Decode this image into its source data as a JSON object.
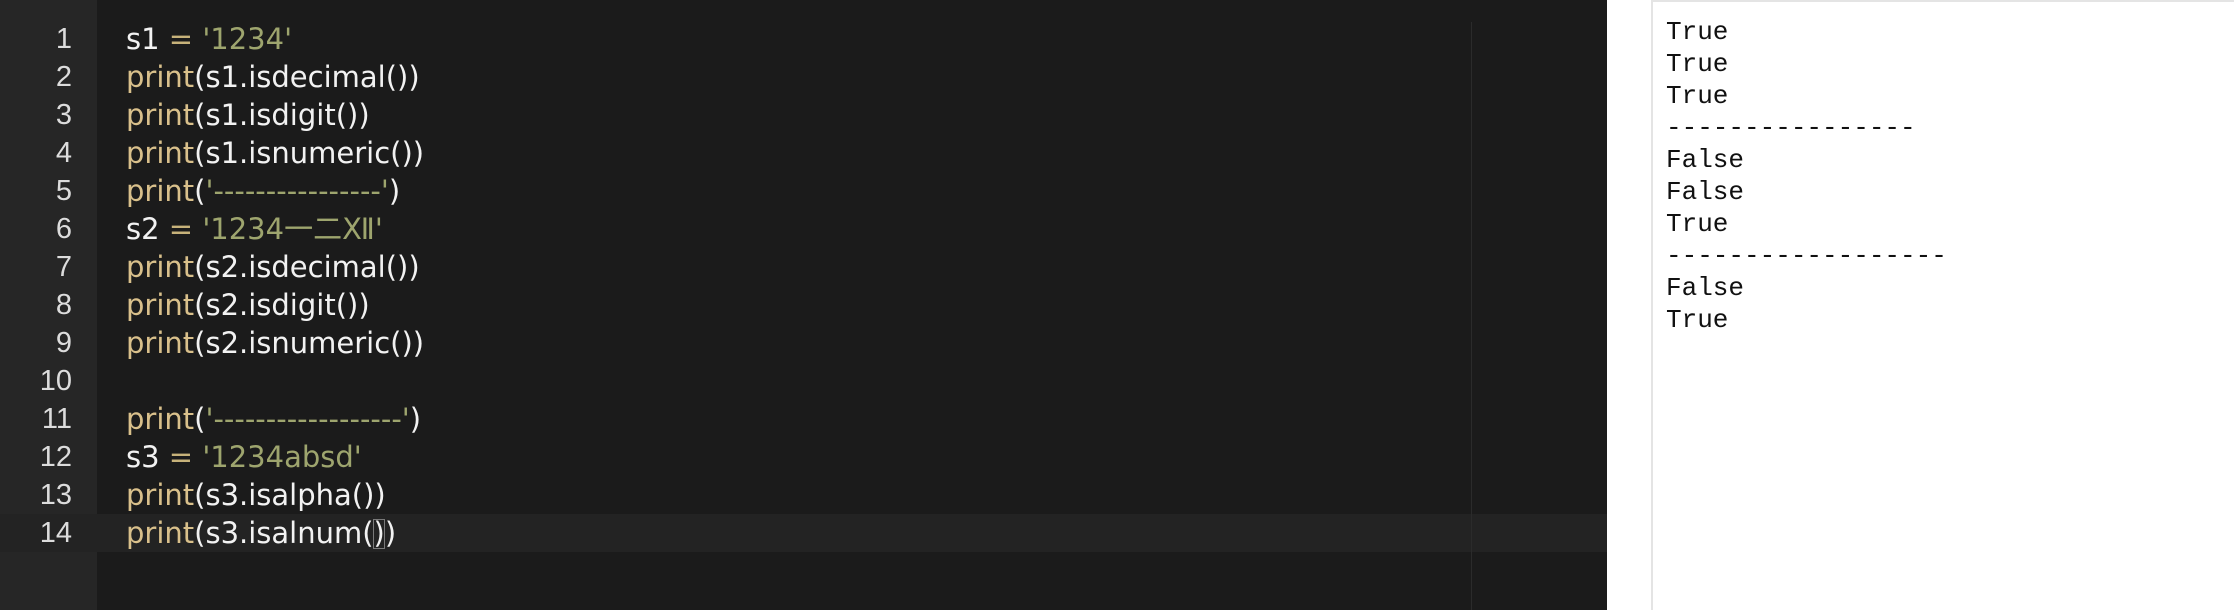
{
  "editor": {
    "lines": [
      {
        "num": "1",
        "parts": [
          {
            "t": "s1 ",
            "c": "plain"
          },
          {
            "t": "=",
            "c": "op"
          },
          {
            "t": " ",
            "c": "plain"
          },
          {
            "t": "'1234'",
            "c": "str"
          }
        ]
      },
      {
        "num": "2",
        "parts": [
          {
            "t": "print",
            "c": "kw"
          },
          {
            "t": "(s1.isdecimal())",
            "c": "plain"
          }
        ]
      },
      {
        "num": "3",
        "parts": [
          {
            "t": "print",
            "c": "kw"
          },
          {
            "t": "(s1.isdigit())",
            "c": "plain"
          }
        ]
      },
      {
        "num": "4",
        "parts": [
          {
            "t": "print",
            "c": "kw"
          },
          {
            "t": "(s1.isnumeric())",
            "c": "plain"
          }
        ]
      },
      {
        "num": "5",
        "parts": [
          {
            "t": "print",
            "c": "kw"
          },
          {
            "t": "(",
            "c": "plain"
          },
          {
            "t": "'----------------'",
            "c": "str"
          },
          {
            "t": ")",
            "c": "plain"
          }
        ]
      },
      {
        "num": "6",
        "parts": [
          {
            "t": "s2 ",
            "c": "plain"
          },
          {
            "t": "=",
            "c": "op"
          },
          {
            "t": " ",
            "c": "plain"
          },
          {
            "t": "'1234一二Ⅻ'",
            "c": "str"
          }
        ]
      },
      {
        "num": "7",
        "parts": [
          {
            "t": "print",
            "c": "kw"
          },
          {
            "t": "(s2.isdecimal())",
            "c": "plain"
          }
        ]
      },
      {
        "num": "8",
        "parts": [
          {
            "t": "print",
            "c": "kw"
          },
          {
            "t": "(s2.isdigit())",
            "c": "plain"
          }
        ]
      },
      {
        "num": "9",
        "parts": [
          {
            "t": "print",
            "c": "kw"
          },
          {
            "t": "(s2.isnumeric())",
            "c": "plain"
          }
        ]
      },
      {
        "num": "10",
        "parts": []
      },
      {
        "num": "11",
        "parts": [
          {
            "t": "print",
            "c": "kw"
          },
          {
            "t": "(",
            "c": "plain"
          },
          {
            "t": "'------------------'",
            "c": "str"
          },
          {
            "t": ")",
            "c": "plain"
          }
        ]
      },
      {
        "num": "12",
        "parts": [
          {
            "t": "s3 ",
            "c": "plain"
          },
          {
            "t": "=",
            "c": "op"
          },
          {
            "t": " ",
            "c": "plain"
          },
          {
            "t": "'1234absd'",
            "c": "str"
          }
        ]
      },
      {
        "num": "13",
        "parts": [
          {
            "t": "print",
            "c": "kw"
          },
          {
            "t": "(s3.isalpha())",
            "c": "plain"
          }
        ]
      },
      {
        "num": "14",
        "parts": [
          {
            "t": "print",
            "c": "kw"
          },
          {
            "t": "(s3.isalnum()",
            "c": "plain"
          },
          {
            "t": "",
            "c": "cursor"
          },
          {
            "t": ")",
            "c": "plain"
          }
        ]
      }
    ]
  },
  "output": {
    "lines": [
      "True",
      "True",
      "True",
      "----------------",
      "False",
      "False",
      "True",
      "------------------",
      "False",
      "True"
    ]
  },
  "colors": {
    "editor_bg": "#1b1b1b",
    "gutter_bg": "#262626",
    "keyword": "#d9c08b",
    "string": "#9ea56e",
    "plain": "#f2f2f2"
  }
}
